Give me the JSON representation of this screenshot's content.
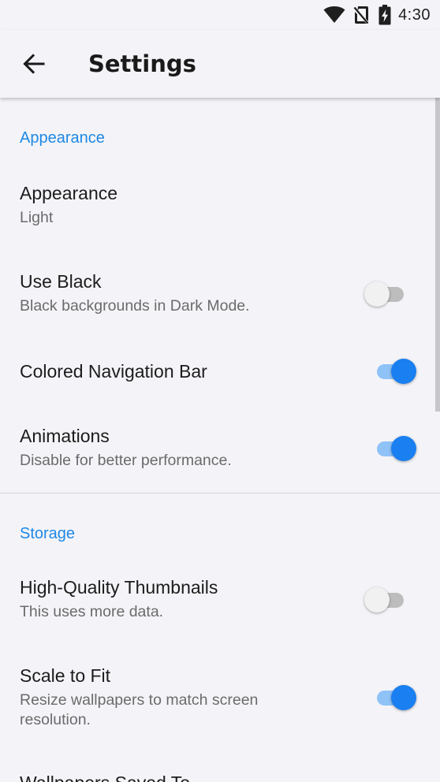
{
  "status_bar": {
    "time": "4:30",
    "icons": [
      "wifi-icon",
      "no-sim-icon",
      "battery-charging-icon"
    ]
  },
  "toolbar": {
    "back_icon": "arrow-back-icon",
    "title": "Settings"
  },
  "accent_color": "#1e88e5",
  "switch_on_color": "#1a7ff0",
  "sections": {
    "appearance": {
      "header": "Appearance",
      "items": {
        "appearance": {
          "title": "Appearance",
          "summary": "Light"
        },
        "use_black": {
          "title": "Use Black",
          "summary": "Black backgrounds in Dark Mode.",
          "checked": false
        },
        "colored_nav_bar": {
          "title": "Colored Navigation Bar",
          "checked": true
        },
        "animations": {
          "title": "Animations",
          "summary": "Disable for better performance.",
          "checked": true
        }
      }
    },
    "storage": {
      "header": "Storage",
      "items": {
        "hq_thumbnails": {
          "title": "High-Quality Thumbnails",
          "summary": "This uses more data.",
          "checked": false
        },
        "scale_to_fit": {
          "title": "Scale to Fit",
          "summary": "Resize wallpapers to match screen resolution.",
          "checked": true
        },
        "wallpapers_saved_to": {
          "title": "Wallpapers Saved To"
        }
      }
    }
  }
}
